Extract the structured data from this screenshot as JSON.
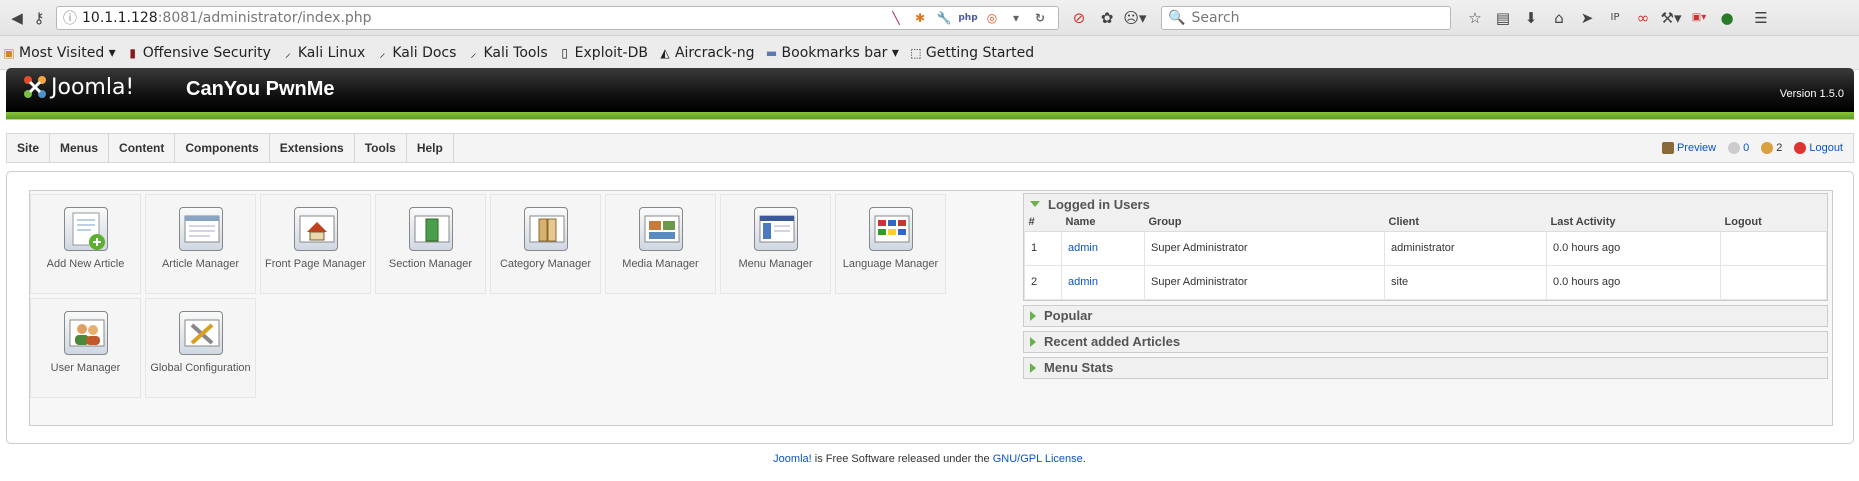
{
  "browser": {
    "url_host": "10.1.1.128",
    "url_path": ":8081/administrator/index.php",
    "search_placeholder": "Search"
  },
  "bookmarks": [
    {
      "label": "Most Visited ▾",
      "icon": "folder-icon"
    },
    {
      "label": "Offensive Security",
      "icon": "offsec-icon"
    },
    {
      "label": "Kali Linux",
      "icon": "kali-icon"
    },
    {
      "label": "Kali Docs",
      "icon": "kali-icon"
    },
    {
      "label": "Kali Tools",
      "icon": "kali-icon"
    },
    {
      "label": "Exploit-DB",
      "icon": "exploitdb-icon"
    },
    {
      "label": "Aircrack-ng",
      "icon": "aircrack-icon"
    },
    {
      "label": "Bookmarks bar ▾",
      "icon": "folder-icon"
    },
    {
      "label": "Getting Started",
      "icon": "page-icon"
    }
  ],
  "header": {
    "logo_text": "Joomla!",
    "site_name": "CanYou PwnMe",
    "version": "Version 1.5.0"
  },
  "menu": [
    "Site",
    "Menus",
    "Content",
    "Components",
    "Extensions",
    "Tools",
    "Help"
  ],
  "status": {
    "preview": "Preview",
    "messages": "0",
    "users": "2",
    "logout": "Logout"
  },
  "cpanel": [
    {
      "label": "Add New Article",
      "icon": "add-article-icon"
    },
    {
      "label": "Article Manager",
      "icon": "article-manager-icon"
    },
    {
      "label": "Front Page Manager",
      "icon": "frontpage-icon"
    },
    {
      "label": "Section Manager",
      "icon": "section-icon"
    },
    {
      "label": "Category Manager",
      "icon": "category-icon"
    },
    {
      "label": "Media Manager",
      "icon": "media-icon"
    },
    {
      "label": "Menu Manager",
      "icon": "menu-manager-icon"
    },
    {
      "label": "Language Manager",
      "icon": "language-icon"
    },
    {
      "label": "User Manager",
      "icon": "user-manager-icon"
    },
    {
      "label": "Global Configuration",
      "icon": "config-icon"
    }
  ],
  "logged_in": {
    "title": "Logged in Users",
    "columns": [
      "#",
      "Name",
      "Group",
      "Client",
      "Last Activity",
      "Logout"
    ],
    "rows": [
      [
        "1",
        "admin",
        "Super Administrator",
        "administrator",
        "0.0 hours ago",
        ""
      ],
      [
        "2",
        "admin",
        "Super Administrator",
        "site",
        "0.0 hours ago",
        ""
      ]
    ]
  },
  "panes": [
    "Popular",
    "Recent added Articles",
    "Menu Stats"
  ],
  "footer": {
    "link1": "Joomla!",
    "text": " is Free Software released under the ",
    "link2": "GNU/GPL License",
    "end": "."
  }
}
